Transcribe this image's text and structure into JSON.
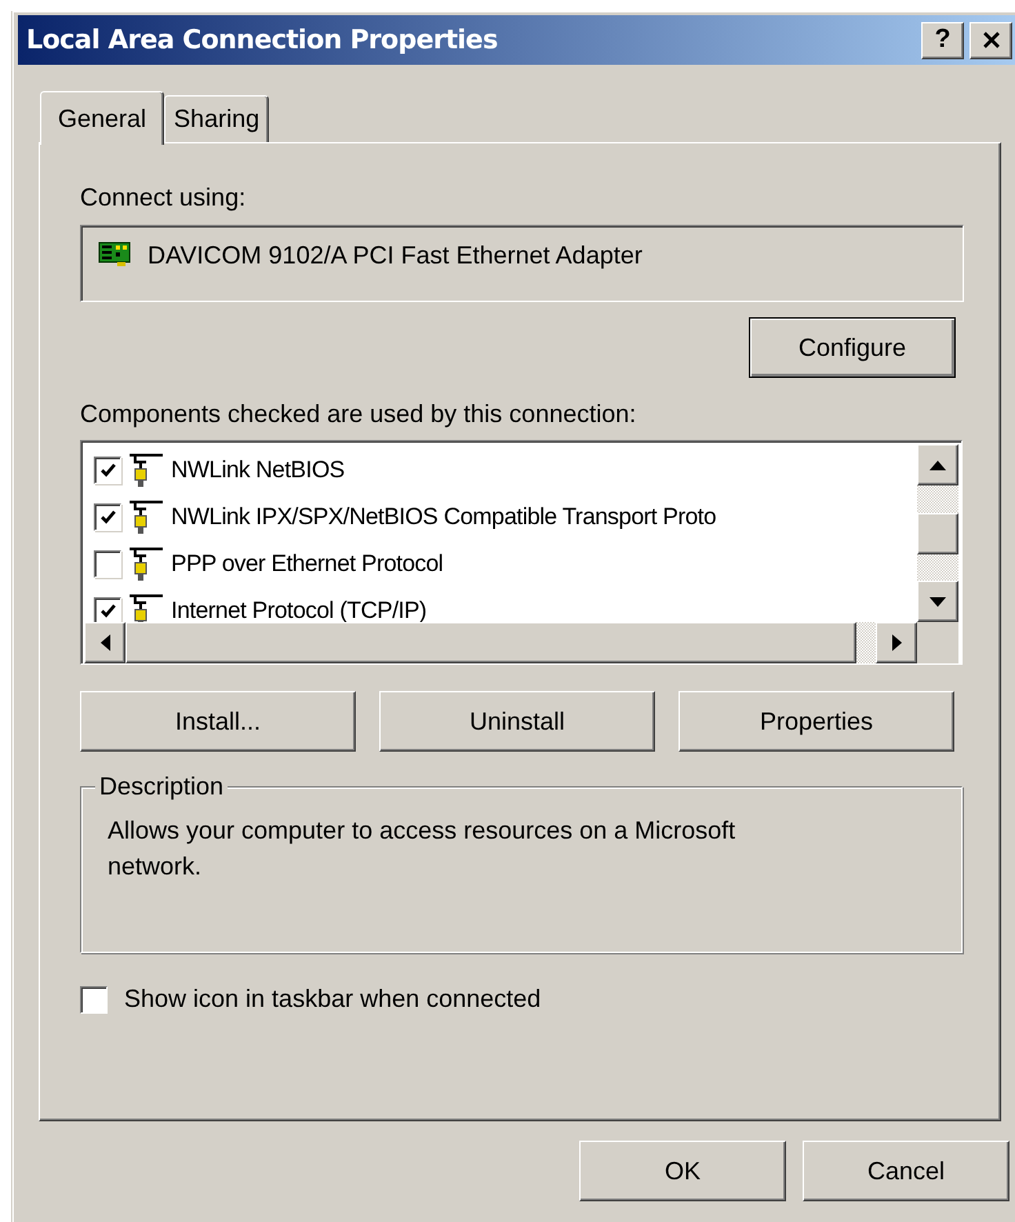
{
  "window": {
    "title": "Local Area Connection Properties",
    "help_button": "?"
  },
  "tabs": [
    {
      "label": "General",
      "selected": true
    },
    {
      "label": "Sharing",
      "selected": false
    }
  ],
  "connect_using": {
    "label": "Connect using:",
    "adapter": "DAVICOM 9102/A PCI Fast Ethernet Adapter",
    "button": "Configure"
  },
  "components": {
    "label": "Components checked are used by this connection:",
    "items": [
      {
        "label": "NWLink NetBIOS",
        "checked": true
      },
      {
        "label": "NWLink IPX/SPX/NetBIOS Compatible Transport Proto",
        "checked": true
      },
      {
        "label": "PPP over Ethernet Protocol",
        "checked": false
      },
      {
        "label": "Internet Protocol (TCP/IP)",
        "checked": true
      }
    ]
  },
  "action_buttons": [
    "Install...",
    "Uninstall",
    "Properties"
  ],
  "description": {
    "legend": "Description",
    "text": "Allows your computer to access resources on a Microsoft network."
  },
  "show_icon": {
    "label": "Show icon in taskbar when connected",
    "checked": false
  },
  "dialog_buttons": [
    "OK",
    "Cancel"
  ]
}
